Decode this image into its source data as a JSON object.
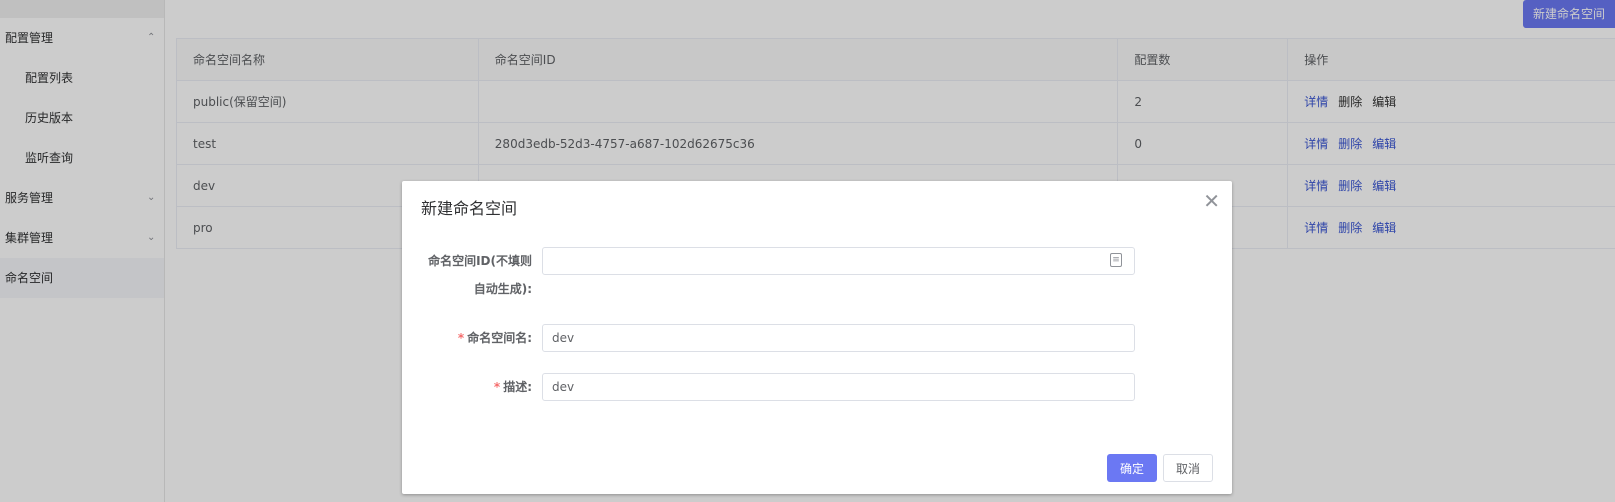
{
  "sidebar": {
    "config_mgmt": {
      "label": "配置管理",
      "chevron": "chevron-up-icon"
    },
    "config_sub": [
      "配置列表",
      "历史版本",
      "监听查询"
    ],
    "service_mgmt": {
      "label": "服务管理",
      "chevron": "chevron-down-icon"
    },
    "cluster_mgmt": {
      "label": "集群管理",
      "chevron": "chevron-down-icon"
    },
    "namespace": {
      "label": "命名空间"
    }
  },
  "main": {
    "new_button": "新建命名空间",
    "table": {
      "headers": [
        "命名空间名称",
        "命名空间ID",
        "配置数",
        "操作"
      ],
      "rows": [
        {
          "name": "public(保留空间)",
          "id": "",
          "count": "2"
        },
        {
          "name": "test",
          "id": "280d3edb-52d3-4757-a687-102d62675c36",
          "count": "0"
        },
        {
          "name": "dev",
          "id": "",
          "count": ""
        },
        {
          "name": "pro",
          "id": "",
          "count": ""
        }
      ],
      "ops": {
        "detail": "详情",
        "delete": "删除",
        "edit": "编辑"
      }
    }
  },
  "dialog": {
    "title": "新建命名空间",
    "id_label_line1": "命名空间ID(不填则",
    "id_label_line2": "自动生成):",
    "id_value": "",
    "name_label": "命名空间名:",
    "name_value": "dev",
    "desc_label": "描述:",
    "desc_value": "dev",
    "required_mark": "*",
    "confirm": "确定",
    "cancel": "取消"
  },
  "colors": {
    "accent": "#6b78f3",
    "link": "#3a56d4",
    "required": "#f56c6c"
  }
}
